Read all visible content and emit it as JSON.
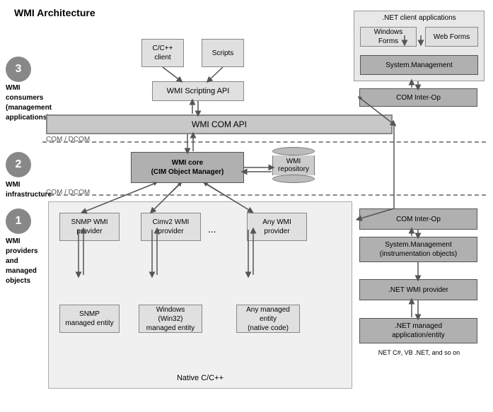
{
  "title": "WMI Architecture",
  "layers": {
    "layer3": {
      "number": "3",
      "label": "WMI consumers\n(management\napplications)"
    },
    "layer2": {
      "number": "2",
      "label": "WMI infrastructure"
    },
    "layer1": {
      "number": "1",
      "label": "WMI providers\nand managed\nobjects"
    }
  },
  "separators": {
    "com_dcom_top": "COM / DCOM",
    "com_dcom_bottom": "COM / DCOM"
  },
  "boxes": {
    "wmi_com_api": "WMI COM API",
    "c_cpp_client": "C/C++\nclient",
    "scripts": "Scripts",
    "wmi_scripting_api": "WMI Scripting API",
    "wmi_core": "WMI core\n(CIM Object Manager)",
    "wmi_repository": "WMI\nrepository",
    "snmp_wmi_provider": "SNMP WMI\nprovider",
    "cimv2_wmi_provider": "Cimv2 WMI\nprovider",
    "any_wmi_provider": "Any WMI\nprovider",
    "snmp_managed_entity": "SNMP\nmanaged entity",
    "windows_managed_entity": "Windows (Win32)\nmanaged entity",
    "any_managed_entity": "Any managed\nentity\n(native code)",
    "native_label": "Native C/C++",
    "dotnet_client_apps": ".NET client applications",
    "windows_forms": "Windows Forms",
    "web_forms": "Web Forms",
    "system_management_top": "System.Management",
    "com_interop_top": "COM Inter-Op",
    "com_interop_bottom": "COM Inter-Op",
    "system_management_bottom": "System.Management\n(instrumentation objects)",
    "dotnet_wmi_provider": ".NET WMI provider",
    "dotnet_managed_app": ".NET managed\napplication/entity",
    "dotnet_footnote": "NET C#, VB .NET, and so on",
    "ellipsis": "..."
  }
}
